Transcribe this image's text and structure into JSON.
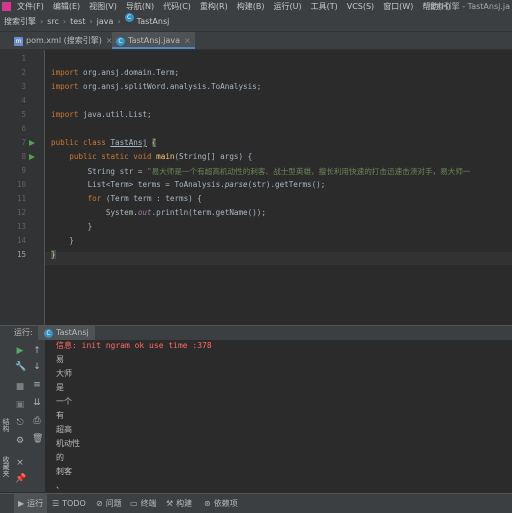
{
  "menubar": {
    "items": [
      "文件(F)",
      "编辑(E)",
      "视图(V)",
      "导航(N)",
      "代码(C)",
      "重构(R)",
      "构建(B)",
      "运行(U)",
      "工具(T)",
      "VCS(S)",
      "窗口(W)",
      "帮助(H)"
    ],
    "window_title": "搜索引擎 - TastAnsj.ja"
  },
  "breadcrumb": [
    "搜索引擎",
    "src",
    "test",
    "java",
    "TastAnsj"
  ],
  "tabs": [
    {
      "icon": "m",
      "label": "pom.xml (搜索引擎)"
    },
    {
      "icon": "c",
      "label": "TastAnsj.java"
    }
  ],
  "editor": {
    "line_numbers": [
      "1",
      "2",
      "3",
      "4",
      "5",
      "6",
      "7",
      "8",
      "9",
      "10",
      "11",
      "12",
      "13",
      "14",
      "15"
    ],
    "lines": {
      "l2_kw": "import",
      "l2_rest": " org.ansj.domain.Term;",
      "l3_kw": "import",
      "l3_rest": " org.ansj.splitWord.analysis.ToAnalysis;",
      "l5_kw": "import",
      "l5_rest": " java.util.List;",
      "l7_kw": "public class ",
      "l7_cls": "TastAnsj",
      "l7_brace": "{",
      "l8_kw": "public static void ",
      "l8_fn": "main",
      "l8_rest": "(String[] args) {",
      "l9_pre": "String str = ",
      "l9_str": "\"易大师是一个有超高机动性的刺客、战士型英雄，擅长利用快速的打击迅速击溃对手，易大师一",
      "l10_pre": "List<Term> terms = ToAnalysis.",
      "l10_it": "parse",
      "l10_rest": "(str).getTerms();",
      "l11_kw": "for ",
      "l11_rest": "(Term term : terms) {",
      "l12_pre": "System.",
      "l12_fld": "out",
      "l12_rest": ".println(term.getName());",
      "l13": "}",
      "l14": "}",
      "l15": "}"
    }
  },
  "run_panel": {
    "label": "运行:",
    "tab": "TastAnsj",
    "output": [
      "信息: init ngram ok use time :378",
      "易",
      "大师",
      "是",
      "一个",
      "有",
      "超高",
      "机动性",
      "的",
      "刺客",
      "、"
    ]
  },
  "left_strip": {
    "items": [
      "结构",
      "收藏夹"
    ]
  },
  "bottom_bar": {
    "items": [
      "运行",
      "TODO",
      "问题",
      "终端",
      "构建",
      "依赖项"
    ]
  }
}
